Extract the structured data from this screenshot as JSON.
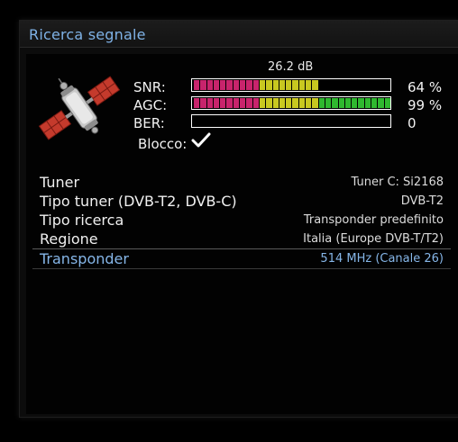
{
  "window": {
    "title": "Ricerca segnale"
  },
  "signal": {
    "db_reading": "26.2 dB",
    "meters": [
      {
        "label": "SNR:",
        "value": "64 %",
        "fill": 0.64
      },
      {
        "label": "AGC:",
        "value": "99 %",
        "fill": 0.99
      },
      {
        "label": "BER:",
        "value": "0",
        "fill": 0.0
      }
    ],
    "lock_label": "Blocco:",
    "locked": true
  },
  "details": [
    {
      "label": "Tuner",
      "value": "Tuner C: Si2168"
    },
    {
      "label": "Tipo tuner (DVB-T2, DVB-C)",
      "value": "DVB-T2"
    },
    {
      "label": "Tipo ricerca",
      "value": "Transponder predefinito"
    },
    {
      "label": "Regione",
      "value": "Italia (Europe DVB-T/T2)"
    },
    {
      "label": "Transponder",
      "value": "514 MHz  (Canale 26)",
      "selected": true
    }
  ],
  "icons": {
    "satellite": "satellite-icon",
    "lock": "checkmark-icon"
  },
  "colors": {
    "title": "#7fb2e6",
    "selected_text": "#86b6e8",
    "seg_red": "#c8246c",
    "seg_yellow": "#c8c820",
    "seg_green": "#2fb82f"
  }
}
